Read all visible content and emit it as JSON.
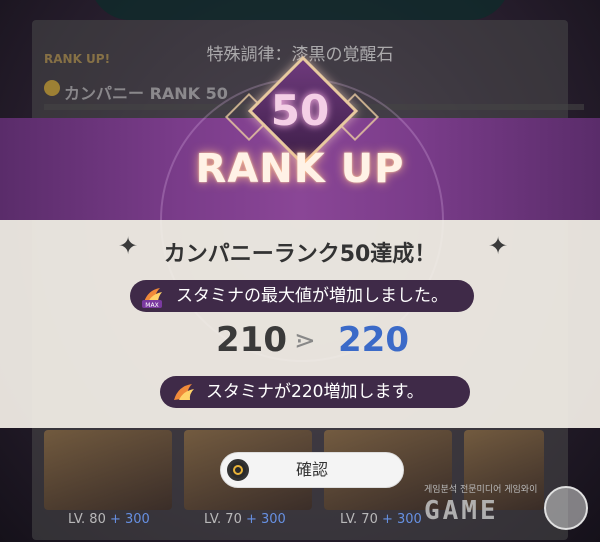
{
  "background": {
    "title": "特殊調律：漆黒の覚醒石",
    "rank_label": "RANK UP!",
    "rank_name": "カンパニー RANK 50",
    "levels": [
      {
        "lv": "LV. 80",
        "plus": "+ 300"
      },
      {
        "lv": "LV. 70",
        "plus": "+ 300"
      },
      {
        "lv": "LV. 70",
        "plus": "+ 300"
      }
    ]
  },
  "banner": {
    "rank_number": "50",
    "rank_up_text": "RANK UP"
  },
  "dialog": {
    "headline": "カンパニーランク50達成！",
    "spark_left": "✦",
    "spark_right": "✦",
    "stat_message": "スタミナの最大値が増加しました。",
    "old_value": "210",
    "arrow": "⋗",
    "new_value": "220",
    "increase_message": "スタミナが220増加します。",
    "icons": [
      "stamina-max-icon",
      "stamina-icon"
    ]
  },
  "confirm_button": {
    "label": "確認"
  },
  "watermark": {
    "small": "게임분석 전문미디어 게임와이",
    "brand": "GAME"
  },
  "colors": {
    "accent_new_value": "#3b6ac8",
    "pill_bg": "#3f2a48",
    "band": "#7a3c8a"
  }
}
